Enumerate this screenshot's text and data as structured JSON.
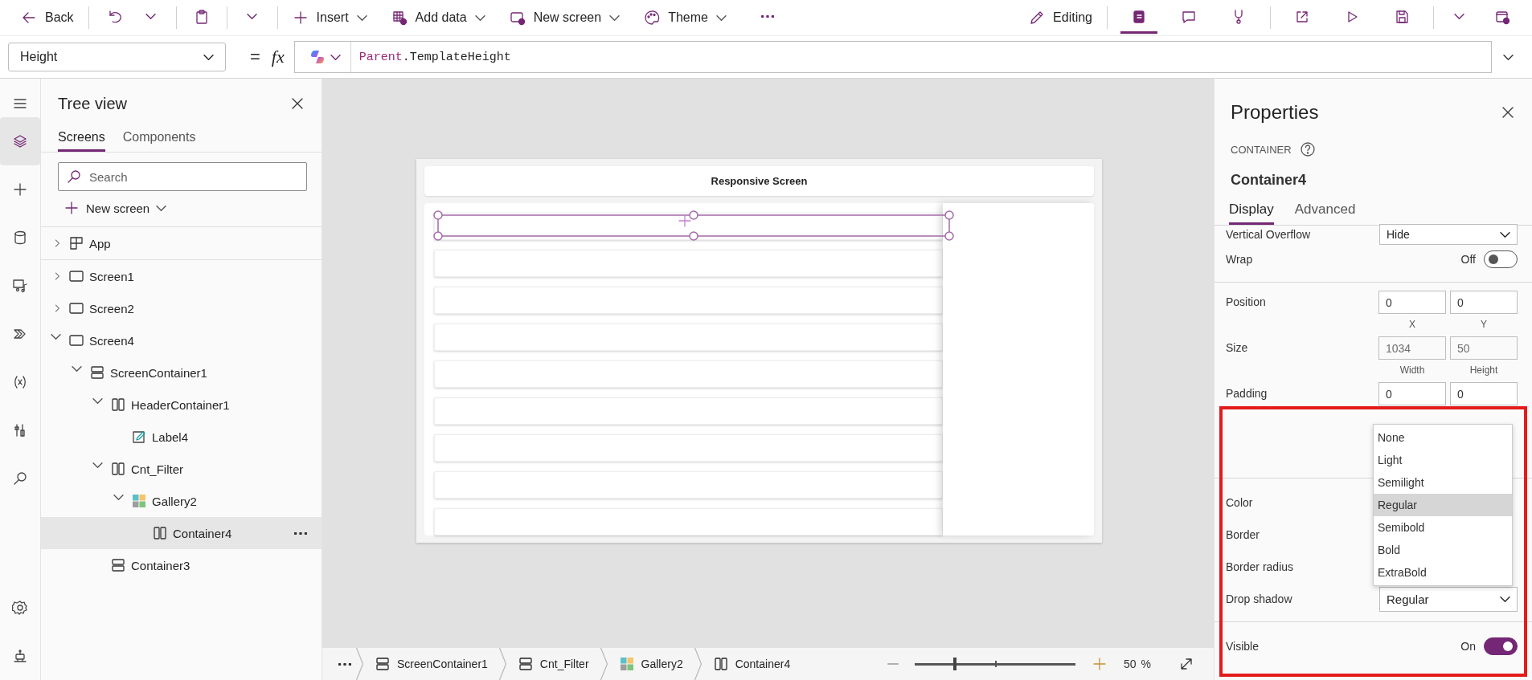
{
  "toolbar": {
    "back": "Back",
    "commands": [
      {
        "kind": "insert",
        "label": "Insert"
      },
      {
        "kind": "add_data",
        "label": "Add data"
      },
      {
        "kind": "new_screen",
        "label": "New screen"
      },
      {
        "kind": "theme",
        "label": "Theme"
      }
    ],
    "mode": "Editing",
    "tools": [
      {
        "kind": "tree",
        "selected": true
      },
      {
        "kind": "comment",
        "selected": false
      },
      {
        "kind": "checker",
        "selected": false
      },
      {
        "kind": "share",
        "selected": false
      },
      {
        "kind": "play",
        "selected": false
      },
      {
        "kind": "save",
        "selected": false
      },
      {
        "kind": "publish",
        "selected": false
      }
    ]
  },
  "formula_bar": {
    "property": "Height",
    "operator": "=",
    "fx": "fx",
    "formula": [
      {
        "text": "Parent",
        "kind": "keyword"
      },
      {
        "text": ".TemplateHeight",
        "kind": "plain"
      }
    ]
  },
  "rail": {
    "items": [
      {
        "kind": "layers",
        "selected": true
      },
      {
        "kind": "insert",
        "selected": false
      },
      {
        "kind": "data",
        "selected": false
      },
      {
        "kind": "media",
        "selected": false
      },
      {
        "kind": "flow",
        "selected": false
      },
      {
        "kind": "variables",
        "selected": false
      },
      {
        "kind": "tools",
        "selected": false
      },
      {
        "kind": "search",
        "selected": false
      }
    ],
    "bottom_items": [
      {
        "kind": "settings",
        "selected": false
      },
      {
        "kind": "bot",
        "selected": false
      }
    ]
  },
  "tree_view": {
    "title": "Tree view",
    "tabs": [
      {
        "label": "Screens",
        "selected": true
      },
      {
        "label": "Components",
        "selected": false
      }
    ],
    "search": {
      "placeholder": "Search"
    },
    "new_screen": "New screen",
    "app": {
      "label": "App",
      "kind": "app",
      "expanded": false,
      "selected": false
    },
    "items": [
      {
        "label": "Screen1",
        "kind": "screen",
        "expanded": false,
        "selected": false
      },
      {
        "label": "Screen2",
        "kind": "screen",
        "expanded": false,
        "selected": false
      },
      {
        "label": "Screen4",
        "kind": "screen",
        "expanded": true,
        "selected": false,
        "children": [
          {
            "label": "ScreenContainer1",
            "kind": "stack",
            "expanded": true,
            "selected": false,
            "children": [
              {
                "label": "HeaderContainer1",
                "kind": "columns",
                "expanded": true,
                "selected": false,
                "children": [
                  {
                    "label": "Label4",
                    "kind": "label",
                    "selected": false
                  }
                ]
              },
              {
                "label": "Cnt_Filter",
                "kind": "columns",
                "expanded": true,
                "selected": false,
                "children": [
                  {
                    "label": "Gallery2",
                    "kind": "gallery",
                    "expanded": true,
                    "selected": false,
                    "children": [
                      {
                        "label": "Container4",
                        "kind": "columns",
                        "selected": true
                      }
                    ]
                  }
                ]
              },
              {
                "label": "Container3",
                "kind": "stack",
                "selected": false
              }
            ]
          }
        ]
      }
    ]
  },
  "canvas": {
    "screen_title": "Responsive Screen"
  },
  "breadcrumbs": [
    {
      "label": "ScreenContainer1",
      "kind": "stack"
    },
    {
      "label": "Cnt_Filter",
      "kind": "stack"
    },
    {
      "label": "Gallery2",
      "kind": "gallery"
    },
    {
      "label": "Container4",
      "kind": "columns"
    }
  ],
  "zoom": {
    "level": 0.25,
    "value": "50",
    "unit": "%"
  },
  "properties": {
    "title": "Properties",
    "type": "CONTAINER",
    "name": "Container4",
    "tabs": [
      {
        "label": "Display",
        "selected": true
      },
      {
        "label": "Advanced",
        "selected": false
      }
    ],
    "overflow": {
      "label": "Vertical Overflow",
      "value": "Hide"
    },
    "wrap": {
      "label": "Wrap",
      "state": "Off",
      "on": false
    },
    "position": {
      "label": "Position",
      "fields": [
        {
          "value": "0",
          "caption": "X",
          "disabled": false
        },
        {
          "value": "0",
          "caption": "Y",
          "disabled": false
        }
      ]
    },
    "size": {
      "label": "Size",
      "fields": [
        {
          "value": "1034",
          "caption": "Width",
          "disabled": true
        },
        {
          "value": "50",
          "caption": "Height",
          "disabled": true
        }
      ]
    },
    "padding": {
      "label": "Padding",
      "fields": [
        {
          "value": "0",
          "disabled": false
        },
        {
          "value": "0",
          "disabled": false
        }
      ]
    },
    "style_rows": [
      {
        "label": "Color"
      },
      {
        "label": "Border"
      },
      {
        "label": "Border radius"
      }
    ],
    "drop_shadow": {
      "label": "Drop shadow",
      "value": "Regular"
    },
    "visible": {
      "label": "Visible",
      "state": "On",
      "on": true
    },
    "dropdown_options": [
      {
        "label": "None",
        "selected": false
      },
      {
        "label": "Light",
        "selected": false
      },
      {
        "label": "Semilight",
        "selected": false
      },
      {
        "label": "Regular",
        "selected": true
      },
      {
        "label": "Semibold",
        "selected": false
      },
      {
        "label": "Bold",
        "selected": false
      },
      {
        "label": "ExtraBold",
        "selected": false
      }
    ]
  }
}
